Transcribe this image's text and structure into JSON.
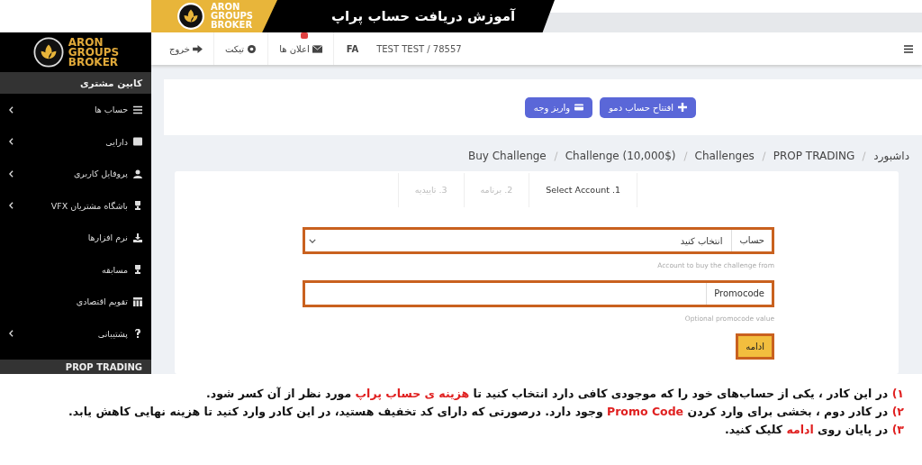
{
  "banner": {
    "title": "آموزش دریافت حساب پراپ",
    "logo": [
      "ARON",
      "GROUPS",
      "BROKER"
    ]
  },
  "topbar": {
    "user": "TEST TEST / 78557",
    "language": "FA",
    "items": [
      {
        "kind": "notifications",
        "label": "اعلان ها",
        "badge": true
      },
      {
        "kind": "ticket",
        "label": "تیکت",
        "badge": false
      },
      {
        "kind": "logout",
        "label": "خروج",
        "badge": false
      }
    ]
  },
  "actions": [
    {
      "kind": "demo",
      "label": "افتتاح حساب دمو"
    },
    {
      "kind": "deposit",
      "label": "واریز وجه"
    }
  ],
  "breadcrumb": [
    "داشبورد",
    "PROP TRADING",
    "Challenges",
    "Challenge (10,000$)",
    "Buy Challenge"
  ],
  "steps": [
    {
      "label": "1. Select Account",
      "selected": true
    },
    {
      "label": "2. برنامه",
      "selected": false
    },
    {
      "label": "3. تاییدیه",
      "selected": false
    }
  ],
  "form": {
    "fields": [
      {
        "kind": "select",
        "label": "حساب",
        "value": "انتخاب کنید",
        "hint": "Account to buy the challenge from",
        "highlighted": true
      },
      {
        "kind": "text",
        "label": "Promocode",
        "hint": "Optional promocode value",
        "highlighted": true
      }
    ],
    "submit": {
      "label": "ادامه",
      "highlighted": true
    }
  },
  "sidebar": {
    "logo": [
      "ARON",
      "GROUPS",
      "BROKER"
    ],
    "header": "کابین مشتری",
    "items": [
      {
        "kind": "list",
        "label": "حساب ها",
        "has_children": true
      },
      {
        "kind": "wallet",
        "label": "دارایی",
        "has_children": true
      },
      {
        "kind": "user",
        "label": "پروفایل کاربری",
        "has_children": true
      },
      {
        "kind": "trophy",
        "label": "باشگاه مشتریان VFX",
        "has_children": true
      },
      {
        "kind": "download",
        "label": "نرم افزارها",
        "has_children": false
      },
      {
        "kind": "trophy",
        "label": "مسابقه",
        "has_children": false
      },
      {
        "kind": "calendar",
        "label": "تقویم اقتصادی",
        "has_children": false
      },
      {
        "kind": "help",
        "label": "پشتیبانی",
        "has_children": true
      }
    ],
    "section": "PROP TRADING"
  },
  "notes": [
    [
      {
        "text": "۱) ",
        "highlight": true
      },
      {
        "text": "در این کادر ، یکی از حساب‌های خود را که موجودی کافی دارد انتخاب کنید تا ",
        "highlight": false
      },
      {
        "text": "هزینه ی حساب پراپ",
        "highlight": true
      },
      {
        "text": " مورد نظر از آن کسر شود.",
        "highlight": false
      }
    ],
    [
      {
        "text": "۲) ",
        "highlight": true
      },
      {
        "text": "در کادر دوم ، بخشی برای وارد کردن ",
        "highlight": false
      },
      {
        "text": "Promo Code",
        "highlight": true
      },
      {
        "text": " وجود دارد. درصورتی که دارای کد تخفیف هستید، در این کادر وارد کنید تا هزینه نهایی کاهش یابد.",
        "highlight": false
      }
    ],
    [
      {
        "text": "۳) ",
        "highlight": true
      },
      {
        "text": "در پایان روی ",
        "highlight": false
      },
      {
        "text": "ادامه",
        "highlight": true
      },
      {
        "text": " کلیک کنید.",
        "highlight": false
      }
    ]
  ]
}
